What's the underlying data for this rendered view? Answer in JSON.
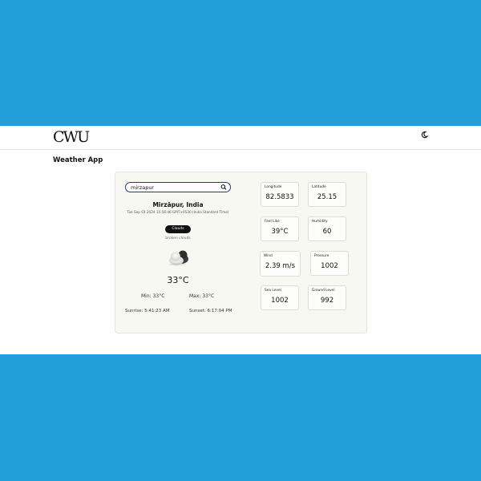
{
  "navbar": {
    "logo_text": "CWU",
    "theme_icon": "moon-icon"
  },
  "app_title": "Weather App",
  "search": {
    "value": "mirzapur",
    "icon": "search-icon"
  },
  "location": {
    "city": "Mirzāpur, India",
    "datetime": "Tue Sep 03 2024 15:58:46 GMT+0530 (India Standard Time)"
  },
  "condition": {
    "badge": "Clouds",
    "description": "broken clouds",
    "icon": "cloud-icon"
  },
  "temperature": "33°C",
  "min": "Min: 33°C",
  "max": "Max: 33°C",
  "sunrise": "Sunrise: 5:41:23 AM",
  "sunset": "Sunset: 6:17:04 PM",
  "stats": [
    {
      "label": "Longitude",
      "value": "82.5833"
    },
    {
      "label": "Latitude",
      "value": "25.15"
    },
    {
      "label": "Feel Like",
      "value": "39°C"
    },
    {
      "label": "Humidity",
      "value": "60"
    },
    {
      "label": "Wind",
      "value": "2.39 m/s"
    },
    {
      "label": "Pressure",
      "value": "1002"
    },
    {
      "label": "Sea Level",
      "value": "1002"
    },
    {
      "label": "Ground Level",
      "value": "992"
    }
  ],
  "colors": {
    "background": "#229fd8",
    "card": "#f8f8f3",
    "search_border": "#1e3a8a"
  }
}
